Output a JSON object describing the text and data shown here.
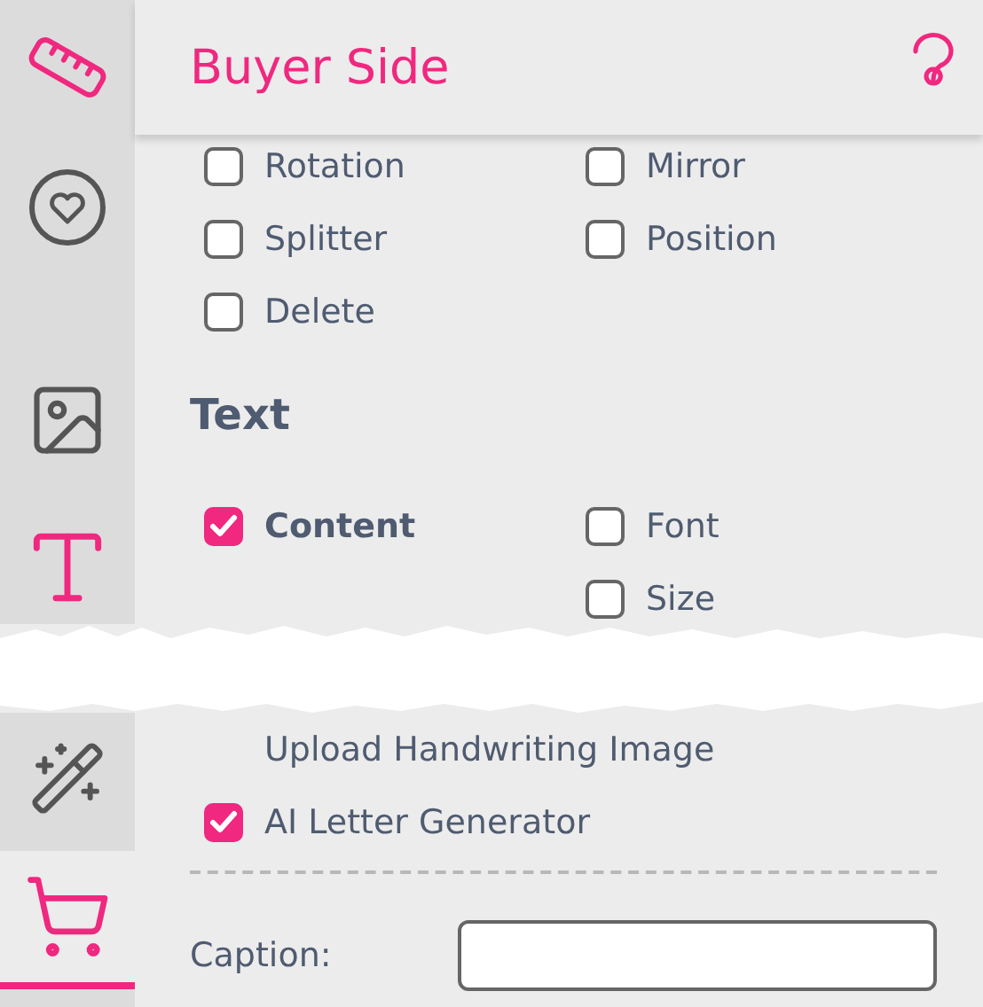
{
  "sidebar": {
    "items": [
      {
        "kind": "ruler",
        "color": "#f0287f",
        "selected": false
      },
      {
        "kind": "heart-badge",
        "color": "#555555",
        "selected": false
      },
      {
        "kind": "image",
        "color": "#555555",
        "selected": false
      },
      {
        "kind": "text",
        "color": "#f0287f",
        "selected": false
      },
      {
        "kind": "wand",
        "color": "#555555",
        "selected": false
      },
      {
        "kind": "cart",
        "color": "#f0287f",
        "selected": true
      }
    ]
  },
  "header": {
    "title": "Buyer Side"
  },
  "options": [
    {
      "label": "Rotation",
      "checked": false
    },
    {
      "label": "Mirror",
      "checked": false
    },
    {
      "label": "Splitter",
      "checked": false
    },
    {
      "label": "Position",
      "checked": false
    },
    {
      "label": "Delete",
      "checked": false
    }
  ],
  "text_section": {
    "title": "Text",
    "rows": [
      {
        "cells": [
          {
            "label": "Content",
            "checked": true
          },
          {
            "label": "Font",
            "checked": false
          }
        ]
      },
      {
        "cells": [
          null,
          {
            "label": "Size",
            "checked": false
          }
        ]
      }
    ],
    "lower_options": [
      {
        "kind": "note",
        "label": "Upload Handwriting Image"
      },
      {
        "kind": "checkbox",
        "label": "AI Letter Generator",
        "checked": true
      }
    ]
  },
  "caption": {
    "label": "Caption:"
  }
}
